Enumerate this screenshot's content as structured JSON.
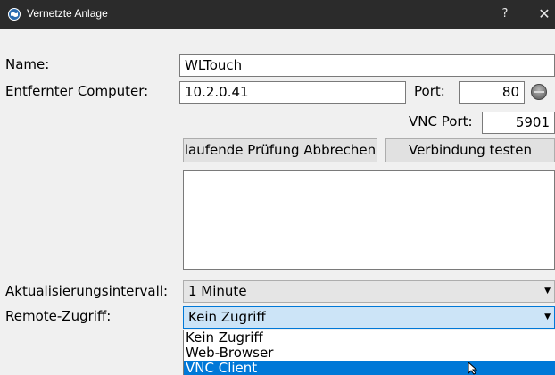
{
  "window": {
    "title": "Vernetzte Anlage",
    "help_glyph": "?",
    "close_glyph": "✕"
  },
  "form": {
    "name_label": "Name:",
    "name_value": "WLTouch",
    "remote_label": "Entfernter Computer:",
    "remote_value": "10.2.0.41",
    "port_label": "Port:",
    "port_value": "80",
    "vnc_port_label": "VNC Port:",
    "vnc_port_value": "5901",
    "cancel_check_label": "laufende Prüfung Abbrechen",
    "test_connection_label": "Verbindung testen",
    "log_text": "",
    "interval_label": "Aktualisierungsintervall:",
    "interval_value": "1 Minute",
    "remote_access_label": "Remote-Zugriff:",
    "remote_access_value": "Kein Zugriff",
    "remote_access_options": [
      "Kein Zugriff",
      "Web-Browser",
      "VNC Client"
    ],
    "remote_access_highlighted": "VNC Client"
  },
  "colors": {
    "titlebar": "#2b2b2b",
    "dialog_bg": "#f0f0f0",
    "accent": "#0078d7",
    "combo_open_bg": "#cce4f7"
  },
  "icons": {
    "app": "globe-icon",
    "status": "status-led-icon",
    "dropdown": "chevron-down-icon",
    "pointer": "mouse-cursor-icon"
  }
}
